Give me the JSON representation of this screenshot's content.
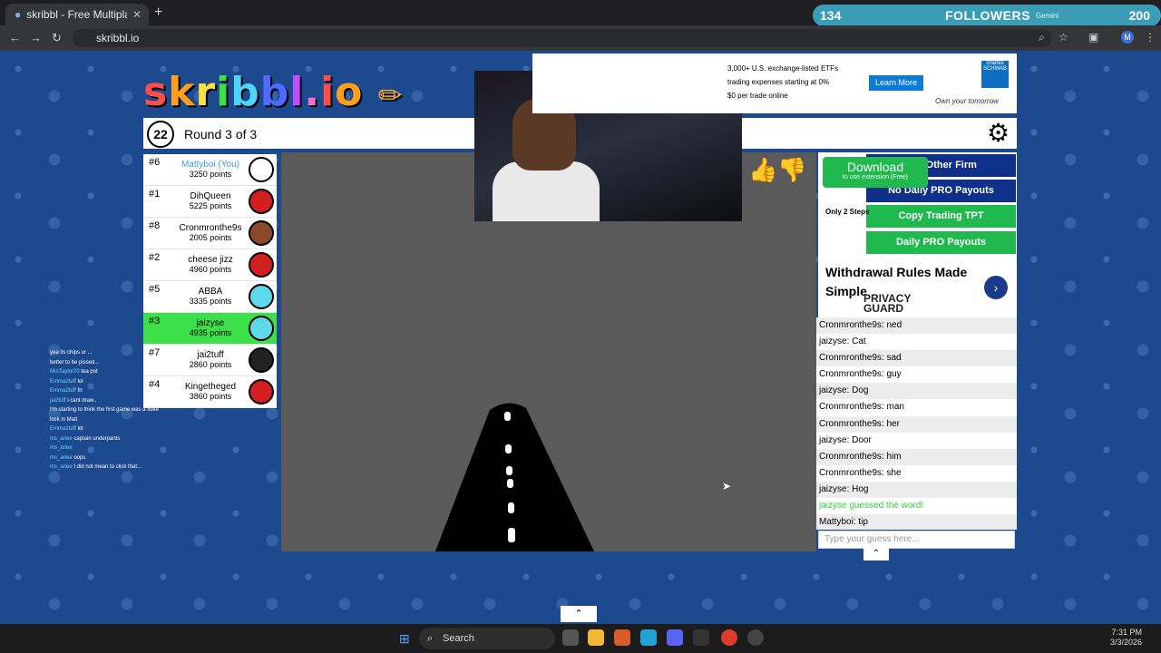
{
  "browser": {
    "tab_title": "skribbl - Free Multiplayer Draw",
    "url": "skribbl.io",
    "followers_count": "134",
    "followers_label": "FOLLOWERS",
    "gemini": "Gemini",
    "right_count": "200"
  },
  "game": {
    "logo": "skribbl.io",
    "timer": "22",
    "round": "Round 3 of 3"
  },
  "players": [
    {
      "rank": "#6",
      "name": "Mattyboi (You)",
      "points": "3250 points",
      "me": true,
      "color": "#ffffff"
    },
    {
      "rank": "#1",
      "name": "DihQueen",
      "points": "5225 points",
      "me": false,
      "color": "#d11f1f"
    },
    {
      "rank": "#8",
      "name": "Cronmronthe9s",
      "points": "2005 points",
      "me": false,
      "color": "#8a4a2a"
    },
    {
      "rank": "#2",
      "name": "cheese jizz",
      "points": "4960 points",
      "me": false,
      "color": "#d11f1f"
    },
    {
      "rank": "#5",
      "name": "ABBA",
      "points": "3335 points",
      "me": false,
      "color": "#5fd8ea"
    },
    {
      "rank": "#3",
      "name": "jaizyse",
      "points": "4935 points",
      "me": false,
      "color": "#5fd8ea",
      "highlight": true
    },
    {
      "rank": "#7",
      "name": "jai2tuff",
      "points": "2860 points",
      "me": false,
      "color": "#222222"
    },
    {
      "rank": "#4",
      "name": "Kingetheged",
      "points": "3860 points",
      "me": false,
      "color": "#d11f1f"
    }
  ],
  "ad_top": {
    "line1": "3,000+ U.S. exchange-listed ETFs",
    "line2": "trading expenses starting at 0%",
    "line3": "$0 per trade online",
    "button": "Learn More",
    "brand": "charles SCHWAB",
    "slogan": "Own your tomorrow"
  },
  "side_ad": {
    "download": "Download",
    "download_sub": "to use extension (Free)",
    "b1": "ling Other Firm",
    "b2": "No Daily PRO Payouts",
    "b3": "Copy Trading TPT",
    "b4": "Daily PRO Payouts",
    "steps": "Only 2 Steps",
    "headline": "Withdrawal Rules Made Simple",
    "guard": "PRIVACY GUARD"
  },
  "chat": [
    {
      "user": "Cronmronthe9s",
      "msg": "ned"
    },
    {
      "user": "jaizyse",
      "msg": "Cat"
    },
    {
      "user": "Cronmronthe9s",
      "msg": "sad"
    },
    {
      "user": "Cronmronthe9s",
      "msg": "guy"
    },
    {
      "user": "jaizyse",
      "msg": "Dog"
    },
    {
      "user": "Cronmronthe9s",
      "msg": "man"
    },
    {
      "user": "Cronmronthe9s",
      "msg": "her"
    },
    {
      "user": "jaizyse",
      "msg": "Door"
    },
    {
      "user": "Cronmronthe9s",
      "msg": "him"
    },
    {
      "user": "Cronmronthe9s",
      "msg": "she"
    },
    {
      "user": "jaizyse",
      "msg": "Hog"
    },
    {
      "user": "",
      "msg": "jaizyse guessed the word!",
      "guess": true
    },
    {
      "user": "Mattyboi",
      "msg": "tip"
    }
  ],
  "guess_placeholder": "Type your guess here...",
  "stream_chat": [
    {
      "user": "",
      "msg": "yea its chips ur ..."
    },
    {
      "user": "",
      "msg": "better to be pissed..."
    },
    {
      "user": "MrsTaylor20",
      "msg": "tea pot"
    },
    {
      "user": "Emma2tuff",
      "msg": "lol"
    },
    {
      "user": "Emma2tuff",
      "msg": "frr"
    },
    {
      "user": "jai2tuff",
      "msg": "i cant draw.."
    },
    {
      "user": "",
      "msg": "I'm starting to think the first game was a fluke"
    },
    {
      "user": "",
      "msg": "lock in Matt"
    },
    {
      "user": "Emma2tuff",
      "msg": "lol"
    },
    {
      "user": "ms_arlee",
      "msg": "captain underpants"
    },
    {
      "user": "ms_arlee",
      "msg": ""
    },
    {
      "user": "ms_arlee",
      "msg": "oops"
    },
    {
      "user": "ms_arlee",
      "msg": "I did not mean to click that..."
    }
  ],
  "taskbar": {
    "search": "Search",
    "time": "7:31 PM",
    "date": "3/3/2026"
  }
}
